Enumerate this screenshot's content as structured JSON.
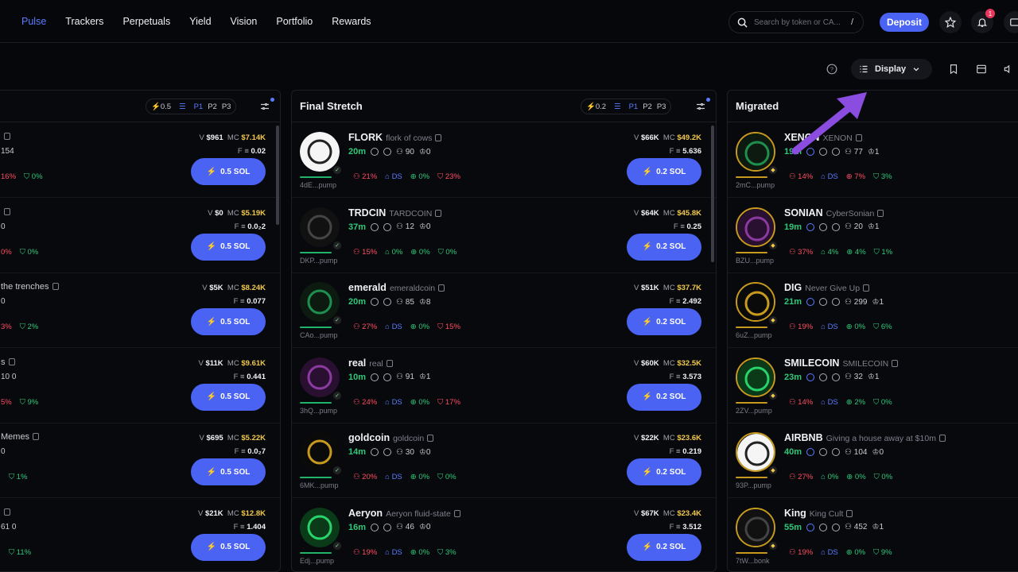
{
  "nav": [
    "Pulse",
    "Trackers",
    "Perpetuals",
    "Yield",
    "Vision",
    "Portfolio",
    "Rewards"
  ],
  "search": {
    "placeholder": "Search by token or CA...",
    "shortcut": "/"
  },
  "deposit_label": "Deposit",
  "notif_count": "1",
  "display_label": "Display",
  "left_col": {
    "pill_amount": "0.5",
    "presets": [
      "P1",
      "P2",
      "P3"
    ],
    "buy_label": "0.5 SOL",
    "rows": [
      {
        "name_tail": "",
        "meta": "154",
        "v": "$961",
        "mc": "$7.14K",
        "f": "0.02",
        "s1": "16%",
        "s2": "0%"
      },
      {
        "name_tail": "",
        "meta": "0",
        "v": "$0",
        "mc": "$5.19K",
        "f": "0.0₂2",
        "s1": "0%",
        "s2": "0%"
      },
      {
        "name_tail": "the trenches",
        "meta": "0",
        "v": "$5K",
        "mc": "$8.24K",
        "f": "0.077",
        "s1": "3%",
        "s2": "2%"
      },
      {
        "name_tail": "s",
        "meta": "10   0",
        "v": "$11K",
        "mc": "$9.61K",
        "f": "0.441",
        "s1": "5%",
        "s2": "9%"
      },
      {
        "name_tail": "Memes",
        "meta": "0",
        "v": "$695",
        "mc": "$5.22K",
        "f": "0.0₂7",
        "s1": "",
        "s2": "1%"
      },
      {
        "name_tail": "",
        "meta": "61   0",
        "v": "$21K",
        "mc": "$12.8K",
        "f": "1.404",
        "s1": "",
        "s2": "11%"
      }
    ]
  },
  "final": {
    "title": "Final Stretch",
    "pill_amount": "0.2",
    "presets": [
      "P1",
      "P2",
      "P3"
    ],
    "buy_label": "0.2 SOL",
    "rows": [
      {
        "name": "FLORK",
        "sub": "flork of cows",
        "age": "20m",
        "c1": "90",
        "c2": "0",
        "v": "$66K",
        "mc": "$49.2K",
        "f": "5.636",
        "pump": "4dE...pump",
        "s": [
          "21%",
          "DS",
          "0%",
          "23%"
        ]
      },
      {
        "name": "TRDCIN",
        "sub": "TARDCOIN",
        "age": "37m",
        "c1": "12",
        "c2": "0",
        "v": "$64K",
        "mc": "$45.8K",
        "f": "0.25",
        "pump": "DKP...pump",
        "s": [
          "15%",
          "0%",
          "0%",
          "0%"
        ]
      },
      {
        "name": "emerald",
        "sub": "emeraldcoin",
        "age": "20m",
        "c1": "85",
        "c2": "8",
        "v": "$51K",
        "mc": "$37.7K",
        "f": "2.492",
        "pump": "CAo...pump",
        "s": [
          "27%",
          "DS",
          "0%",
          "15%"
        ]
      },
      {
        "name": "real",
        "sub": "real",
        "age": "10m",
        "c1": "91",
        "c2": "1",
        "v": "$60K",
        "mc": "$32.5K",
        "f": "3.573",
        "pump": "3hQ...pump",
        "s": [
          "24%",
          "DS",
          "0%",
          "17%"
        ]
      },
      {
        "name": "goldcoin",
        "sub": "goldcoin",
        "age": "14m",
        "c1": "30",
        "c2": "0",
        "v": "$22K",
        "mc": "$23.6K",
        "f": "0.219",
        "pump": "6MK...pump",
        "s": [
          "20%",
          "DS",
          "0%",
          "0%"
        ]
      },
      {
        "name": "Aeryon",
        "sub": "Aeryon fluid-state",
        "age": "16m",
        "c1": "46",
        "c2": "0",
        "v": "$67K",
        "mc": "$23.4K",
        "f": "3.512",
        "pump": "Edj...pump",
        "s": [
          "19%",
          "DS",
          "0%",
          "3%"
        ]
      }
    ]
  },
  "migrated": {
    "title": "Migrated",
    "rows": [
      {
        "name": "XENON",
        "sub": "XENON",
        "age": "19m",
        "c1": "77",
        "c2": "1",
        "pump": "2mC...pump",
        "s": [
          "14%",
          "DS",
          "7%",
          "3%"
        ]
      },
      {
        "name": "SONIAN",
        "sub": "CyberSonian",
        "age": "19m",
        "c1": "20",
        "c2": "1",
        "pump": "BZU...pump",
        "s": [
          "37%",
          "4%",
          "4%",
          "1%"
        ]
      },
      {
        "name": "DIG",
        "sub": "Never Give Up",
        "age": "21m",
        "c1": "299",
        "c2": "1",
        "pump": "6uZ...pump",
        "s": [
          "19%",
          "DS",
          "0%",
          "6%"
        ]
      },
      {
        "name": "SMILECOIN",
        "sub": "SMILECOIN",
        "age": "23m",
        "c1": "32",
        "c2": "1",
        "pump": "2ZV...pump",
        "s": [
          "14%",
          "DS",
          "2%",
          "0%"
        ]
      },
      {
        "name": "AIRBNB",
        "sub": "Giving a house away at $10m",
        "age": "40m",
        "c1": "104",
        "c2": "0",
        "pump": "93P...pump",
        "s": [
          "27%",
          "0%",
          "0%",
          "0%"
        ]
      },
      {
        "name": "King",
        "sub": "King Cult",
        "age": "55m",
        "c1": "452",
        "c2": "1",
        "pump": "7tW...bonk",
        "s": [
          "19%",
          "DS",
          "0%",
          "9%"
        ]
      }
    ]
  },
  "colors": {
    "accent": "#4a63f2",
    "green": "#2fc97a",
    "red": "#ff4d62",
    "gold": "#f2c94c",
    "arrow": "#8b4de0"
  },
  "icons": [
    "search-icon",
    "star-icon",
    "bell-icon",
    "help-icon",
    "list-icon",
    "chevron-down-icon",
    "bookmark-icon",
    "columns-icon",
    "volume-icon",
    "lightning-icon",
    "filter-icon",
    "copy-icon"
  ]
}
